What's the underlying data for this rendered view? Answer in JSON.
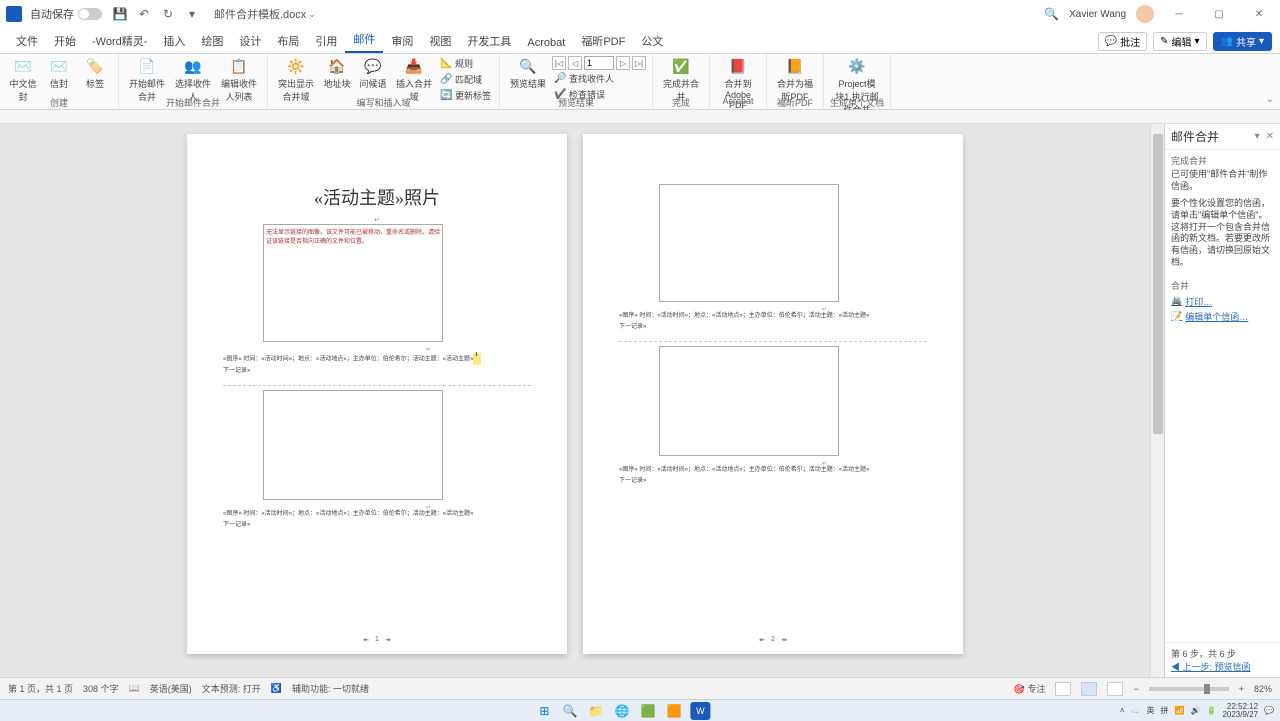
{
  "titlebar": {
    "autosave_label": "自动保存",
    "filename": "邮件合并模板.docx",
    "search_icon": "search",
    "username": "Xavier Wang"
  },
  "tabs": {
    "items": [
      "文件",
      "开始",
      "-Word精灵-",
      "插入",
      "绘图",
      "设计",
      "布局",
      "引用",
      "邮件",
      "审阅",
      "视图",
      "开发工具",
      "Acrobat",
      "福昕PDF",
      "公文"
    ],
    "active_index": 8,
    "comments_btn": "批注",
    "edit_btn": "编辑",
    "share_btn": "共享"
  },
  "ribbon": {
    "groups": [
      {
        "label": "创建",
        "buttons": [
          "中文信封",
          "信封",
          "标签"
        ]
      },
      {
        "label": "开始邮件合并",
        "buttons": [
          "开始邮件合并",
          "选择收件人",
          "编辑收件人列表"
        ]
      },
      {
        "label": "编写和插入域",
        "buttons": [
          "突出显示合并域",
          "地址块",
          "问候语",
          "插入合并域"
        ],
        "side": [
          "规则",
          "匹配域",
          "更新标签"
        ]
      },
      {
        "label": "预览结果",
        "buttons": [
          "预览结果"
        ],
        "side": [
          "查找收件人",
          "检查错误"
        ],
        "record": "1"
      },
      {
        "label": "完成",
        "buttons": [
          "完成并合并"
        ]
      },
      {
        "label": "Acrobat",
        "buttons": [
          "合并到Adobe PDF"
        ]
      },
      {
        "label": "福昕PDF",
        "buttons": [
          "合并为福昕PDF"
        ]
      },
      {
        "label": "生成单个文档",
        "buttons": [
          "Project模块1.执行邮件合并"
        ]
      }
    ]
  },
  "document": {
    "title": "«活动主题»照片",
    "img_error": "无法显示链接的图像。该文件可能已被移动、重命名或删除。请验证该链接是否指向正确的文件和位置。",
    "caption_template": "«图序»   时间：«活动时间»；地点：«活动地点»；主办单位：伯伦希尔；活动主题：«活动主题»",
    "next_record": "下一记录»",
    "page1_num": "1",
    "page2_num": "2"
  },
  "taskpane": {
    "title": "邮件合并",
    "section1_title": "完成合并",
    "section1_body": "已可使用\"邮件合并\"制作信函。",
    "section2_body": "要个性化设置您的信函，请单击\"编辑单个信函\"。这将打开一个包含合并信函的新文档。若要更改所有信函，请切换回原始文档。",
    "section3_title": "合并",
    "link_print": "打印…",
    "link_edit": "编辑单个信函…",
    "step_label": "第 6 步，共 6 步",
    "prev_step": "上一步: 预览信函"
  },
  "statusbar": {
    "page_info": "第 1 页，共 1 页",
    "word_count": "308 个字",
    "language": "英语(美国)",
    "predict": "文本预测: 打开",
    "accessibility": "辅助功能: 一切就绪",
    "focus_label": "专注",
    "zoom": "82%"
  },
  "system": {
    "ime": "英",
    "ime2": "拼",
    "time": "22:52:12",
    "date": "2023/9/27"
  },
  "chart_data": null
}
